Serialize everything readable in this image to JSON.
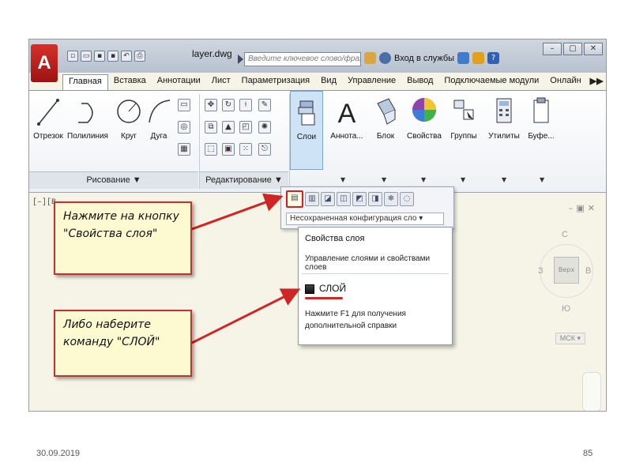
{
  "titlebar": {
    "app_letter": "A",
    "doc_title": "layer.dwg",
    "search_placeholder": "Введите ключевое слово/фразу",
    "signin": "Вход в службы",
    "help": "?"
  },
  "tabs": [
    "Главная",
    "Вставка",
    "Аннотации",
    "Лист",
    "Параметризация",
    "Вид",
    "Управление",
    "Вывод",
    "Подключаемые модули",
    "Онлайн"
  ],
  "tabs_more": "▶▶",
  "ribbon": {
    "draw_tools": [
      "Отрезок",
      "Полилиния",
      "Круг",
      "Дуга"
    ],
    "draw_panel": "Рисование ▼",
    "modify_panel": "Редактирование ▼",
    "big_tools": [
      "Слои",
      "Аннота...",
      "Блок",
      "Свойства",
      "Группы",
      "Утилиты",
      "Буфе..."
    ]
  },
  "flyout": {
    "combo": "Несохраненная конфигурация сло ▾"
  },
  "tooltip": {
    "title": "Свойства слоя",
    "desc": "Управление слоями и свойствами слоев",
    "command": "СЛОЙ",
    "help": "Нажмите F1 для получения дополнительной справки"
  },
  "callouts": {
    "c1_line1": "Нажмите на кнопку",
    "c1_line2": "\"Свойства слоя\"",
    "c2_line1": "Либо наберите",
    "c2_line2": "команду \"СЛОЙ\""
  },
  "viewport": {
    "label": "[–][B",
    "north": "С",
    "south": "Ю",
    "west": "З",
    "east": "В",
    "face": "Верх",
    "wcs": "МСК ▾"
  },
  "footer": {
    "date": "30.09.2019",
    "page": "85"
  }
}
